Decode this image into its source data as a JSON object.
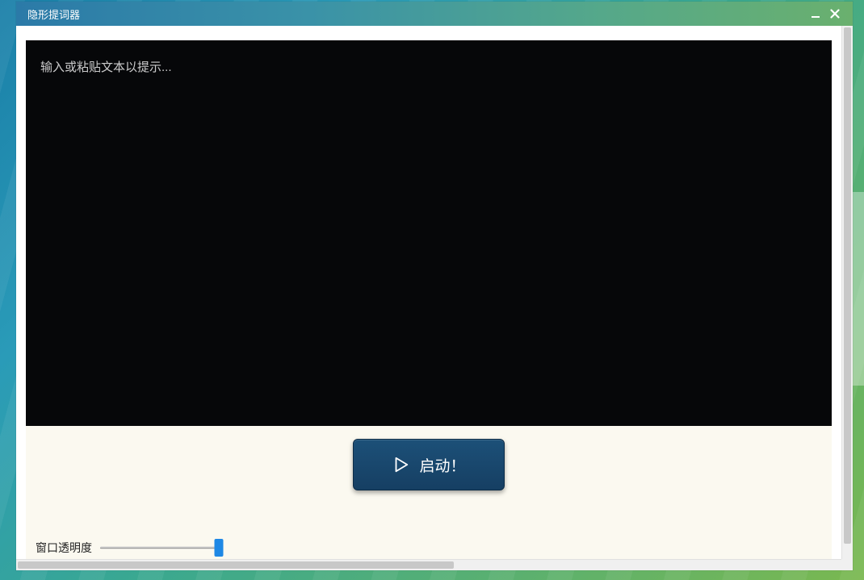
{
  "titlebar": {
    "title": "隐形提词器"
  },
  "editor": {
    "placeholder": "输入或粘贴文本以提示...",
    "value": ""
  },
  "controls": {
    "start_label": "启动！",
    "opacity_label": "窗口透明度",
    "opacity_value": 98
  },
  "colors": {
    "editor_bg": "#060709",
    "button_bg": "#1c5078",
    "panel_bg": "#fbf9f0",
    "slider_thumb": "#1e88e5"
  }
}
